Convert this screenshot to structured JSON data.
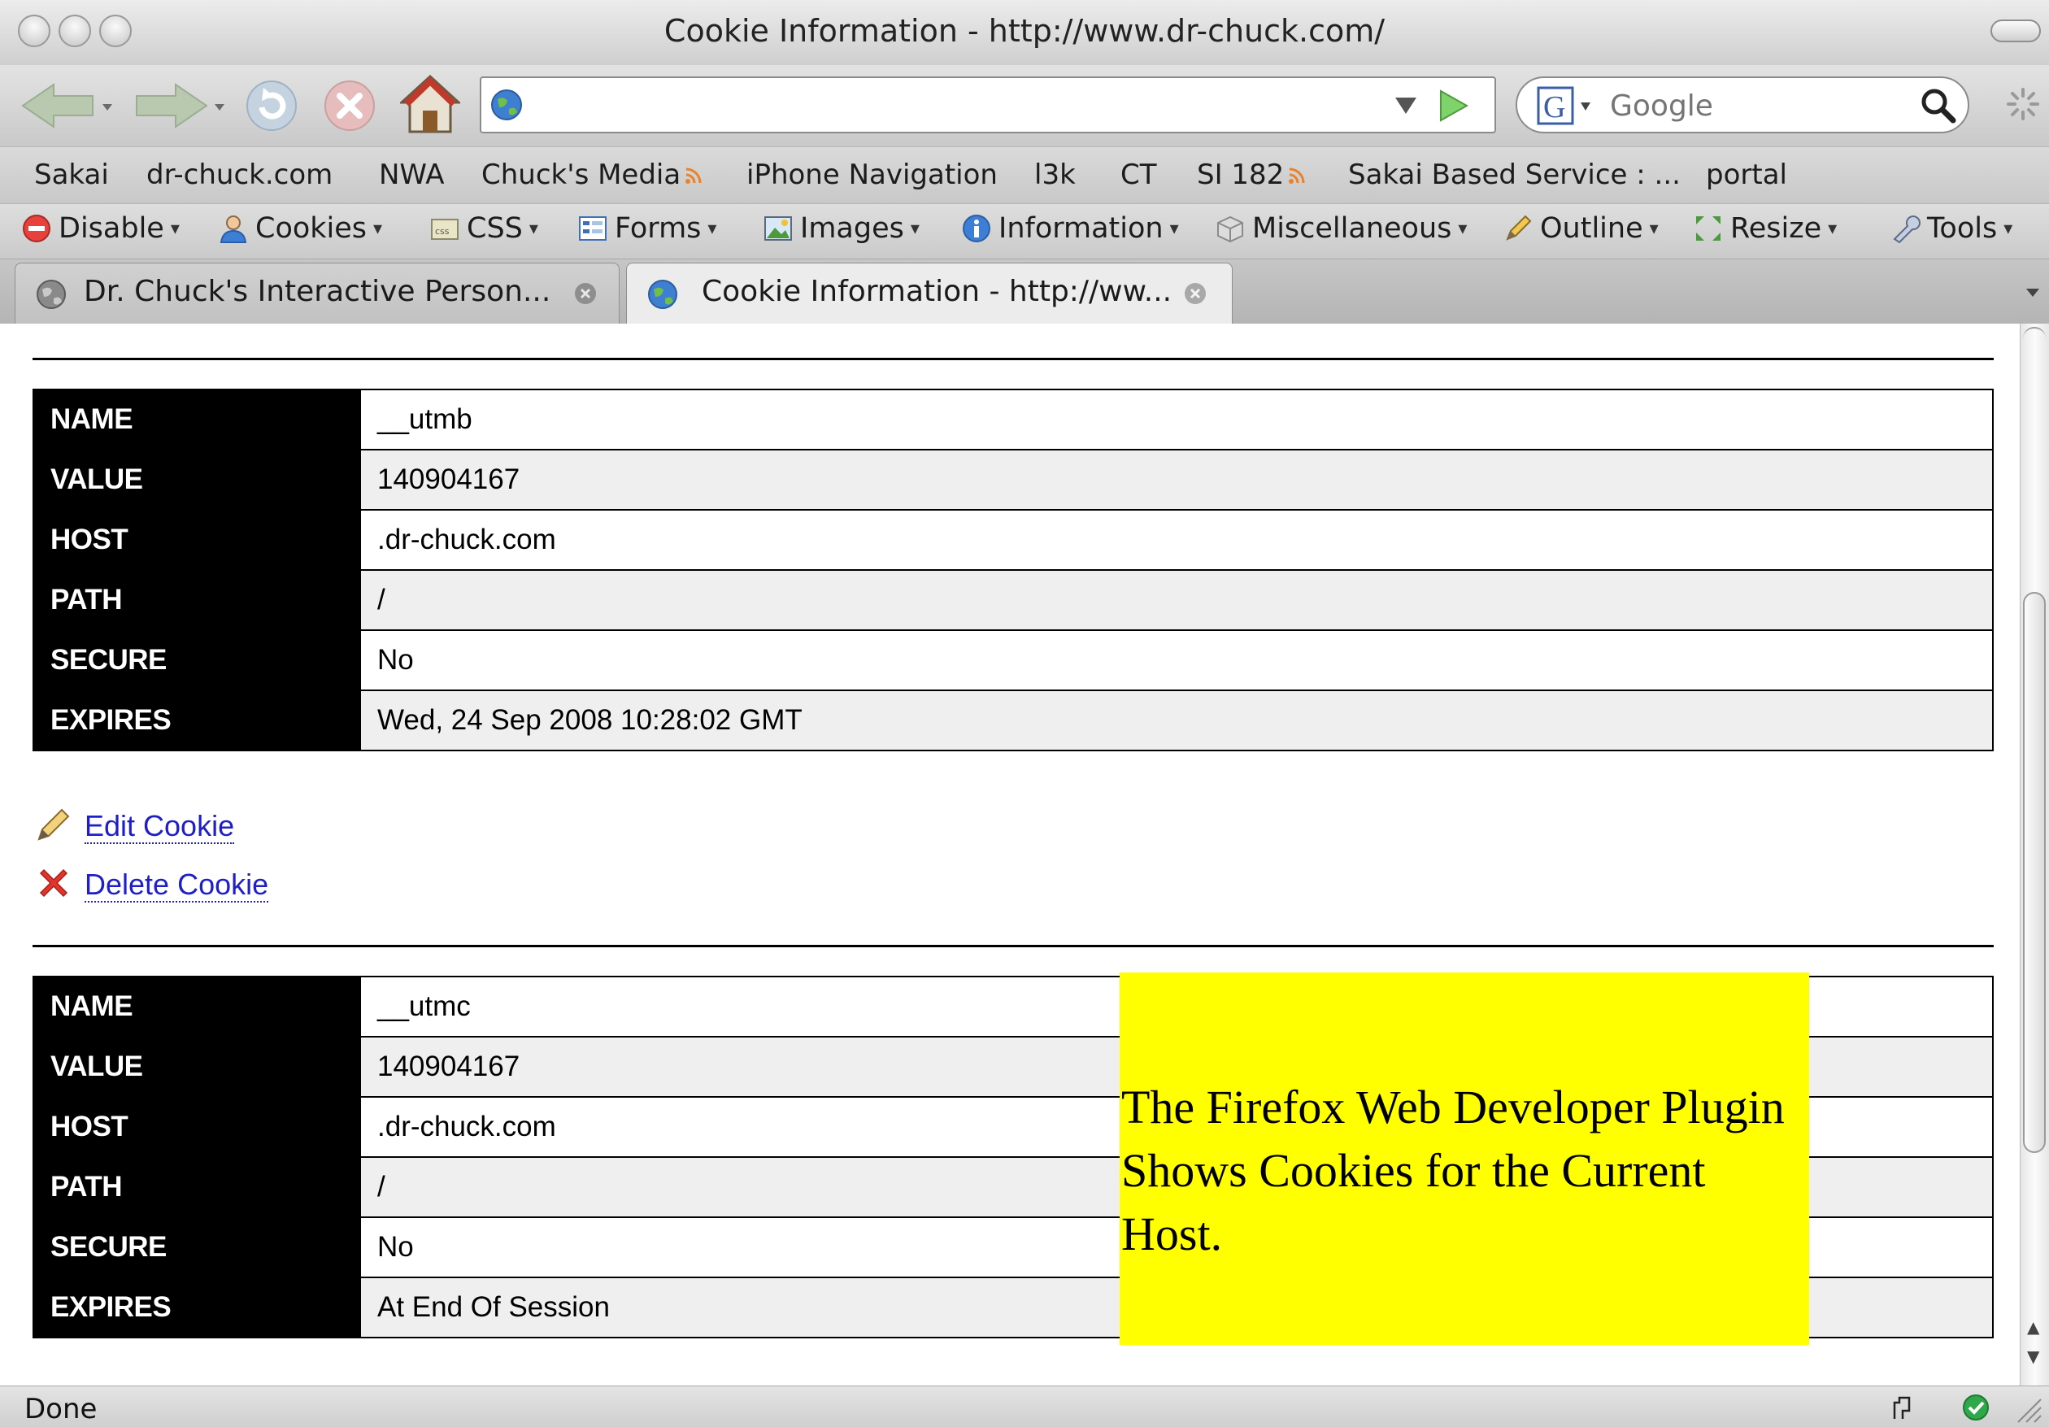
{
  "window": {
    "title": "Cookie Information - http://www.dr-chuck.com/"
  },
  "nav": {
    "url_value": "",
    "search_placeholder": "Google"
  },
  "bookmarks": [
    {
      "label": "Sakai",
      "rss": false
    },
    {
      "label": "dr-chuck.com",
      "rss": false
    },
    {
      "label": "NWA",
      "rss": false
    },
    {
      "label": "Chuck's Media",
      "rss": true
    },
    {
      "label": "iPhone Navigation",
      "rss": false
    },
    {
      "label": "l3k",
      "rss": false
    },
    {
      "label": "CT",
      "rss": false
    },
    {
      "label": "SI 182",
      "rss": true
    },
    {
      "label": "Sakai Based Service : ...",
      "rss": false
    },
    {
      "label": "portal",
      "rss": false
    }
  ],
  "devtoolbar": {
    "disable": "Disable",
    "cookies": "Cookies",
    "css": "CSS",
    "forms": "Forms",
    "images": "Images",
    "information": "Information",
    "miscellaneous": "Miscellaneous",
    "outline": "Outline",
    "resize": "Resize",
    "tools": "Tools",
    "arrow": "▾"
  },
  "tabs": [
    {
      "label": "Dr. Chuck's Interactive Person...",
      "active": false
    },
    {
      "label": "Cookie Information - http://ww...",
      "active": true
    }
  ],
  "cookies": [
    {
      "rows": [
        {
          "key": "NAME",
          "value": "__utmb"
        },
        {
          "key": "VALUE",
          "value": "140904167"
        },
        {
          "key": "HOST",
          "value": ".dr-chuck.com"
        },
        {
          "key": "PATH",
          "value": "/"
        },
        {
          "key": "SECURE",
          "value": "No"
        },
        {
          "key": "EXPIRES",
          "value": "Wed, 24 Sep 2008 10:28:02 GMT"
        }
      ],
      "edit_label": "Edit Cookie",
      "delete_label": "Delete Cookie"
    },
    {
      "rows": [
        {
          "key": "NAME",
          "value": "__utmc"
        },
        {
          "key": "VALUE",
          "value": "140904167"
        },
        {
          "key": "HOST",
          "value": ".dr-chuck.com"
        },
        {
          "key": "PATH",
          "value": "/"
        },
        {
          "key": "SECURE",
          "value": "No"
        },
        {
          "key": "EXPIRES",
          "value": "At End Of Session"
        }
      ]
    }
  ],
  "annotation": {
    "text": "The Firefox Web Developer Plugin Shows Cookies for the Current Host."
  },
  "status": {
    "text": "Done"
  },
  "colors": {
    "annotation_bg": "#ffff00",
    "key_cell_bg": "#000000",
    "link": "#1f1fc8"
  }
}
